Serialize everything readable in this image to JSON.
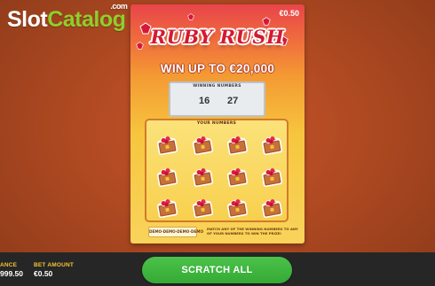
{
  "logo": {
    "slot": "Slot",
    "catalog": "Catalog",
    "com": ".com"
  },
  "ticket": {
    "price": "€0.50",
    "title": "RUBY RUSH",
    "headline": "WIN UP TO €20,000",
    "winning_numbers_label": "WINNING NUMBERS",
    "winning_numbers": [
      "16",
      "27"
    ],
    "your_numbers_label": "YOUR NUMBERS",
    "demo_label": "DEMO·DEMO·DEMO·DEMO",
    "instructions": "MATCH ANY OF THE WINNING NUMBERS TO ANY OF YOUR NUMBERS TO WIN THE PRIZE!"
  },
  "bar": {
    "balance_label": "ANCE",
    "balance_value": "999.50",
    "bet_label": "BET AMOUNT",
    "bet_value": "€0.50",
    "scratch_label": "SCRATCH ALL"
  },
  "colors": {
    "accent_green": "#3bb33a",
    "ruby_red": "#d31a32",
    "label_yellow": "#f4c531"
  },
  "icons": {
    "chest": "ruby-chest-icon",
    "gem": "ruby-gem-icon"
  }
}
